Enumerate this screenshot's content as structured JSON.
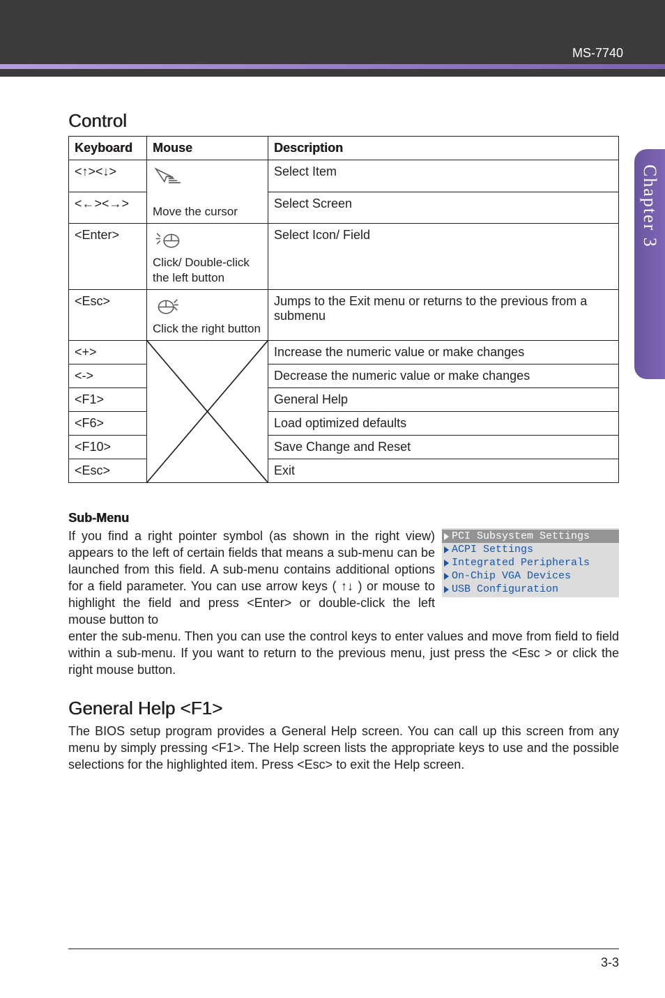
{
  "header": {
    "model": "MS-7740"
  },
  "sidetab": {
    "label": "Chapter 3"
  },
  "sections": {
    "control_title": "Control",
    "submenu_title": "Sub-Menu",
    "general_help_title": "General Help <F1>"
  },
  "table": {
    "headers": {
      "kbd": "Keyboard",
      "mouse": "Mouse",
      "desc": "Description"
    },
    "rows": {
      "r1": {
        "kbd": "<↑><↓>",
        "mouse": "",
        "desc": "Select Item"
      },
      "r2": {
        "kbd": "<←><→>",
        "mouse": "Move the cursor",
        "desc": "Select Screen"
      },
      "r3": {
        "kbd": "<Enter>",
        "mouse_note": "Click/ Double-click the left button",
        "desc": "Select  Icon/ Field"
      },
      "r4": {
        "kbd": "<Esc>",
        "mouse_note": "Click the right button",
        "desc": "Jumps to the Exit menu or returns to the previous from a submenu"
      },
      "r5": {
        "kbd": "<+>",
        "desc": "Increase the numeric value or make changes"
      },
      "r6": {
        "kbd": "<->",
        "desc": "Decrease the numeric value or make changes"
      },
      "r7": {
        "kbd": "<F1>",
        "desc": "General Help"
      },
      "r8": {
        "kbd": "<F6>",
        "desc": "Load optimized defaults"
      },
      "r9": {
        "kbd": "<F10>",
        "desc": "Save Change and Reset"
      },
      "r10": {
        "kbd": "<Esc>",
        "desc": "Exit"
      }
    }
  },
  "submenu_box": {
    "items": [
      "PCI Subsystem Settings",
      "ACPI Settings",
      "Integrated Peripherals",
      "On-Chip VGA Devices",
      "USB Configuration"
    ]
  },
  "paragraphs": {
    "submenu1": "If you find a right pointer symbol (as shown in the right view) appears to the left of certain fields that means a sub-menu can be launched from this field. A sub-menu contains additional options for a field parameter. You can use arrow keys ( ↑↓ ) or mouse to highlight the field and press <Enter> or double-click the left mouse button to",
    "submenu2": "enter the sub-menu. Then you can use the control keys to enter values and  move from field to field within a sub-menu. If you want to return to the previous menu, just press the <Esc > or click the right mouse button.",
    "general": "The BIOS setup program provides a General  Help screen. You can call up this screen from any menu by simply pressing <F1>. The Help screen lists the appropriate keys to use and the possible selections for the highlighted item. Press <Esc> to exit the Help screen."
  },
  "footer": {
    "pagenum": "3-3"
  }
}
